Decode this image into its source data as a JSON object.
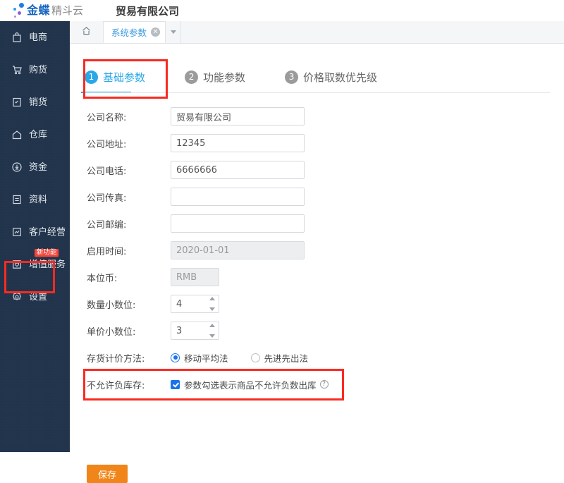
{
  "header": {
    "logo_main": "金蝶",
    "logo_sub": "精斗云",
    "company": "贸易有限公司"
  },
  "tabstrip": {
    "home_icon": "home-icon",
    "doc_tab_label": "系统参数",
    "close_glyph": "✕",
    "caret_icon": "chevron-down-icon"
  },
  "sidebar": {
    "items": [
      {
        "label": "电商",
        "icon": "bag-icon"
      },
      {
        "label": "购货",
        "icon": "cart-icon"
      },
      {
        "label": "销货",
        "icon": "invoice-icon"
      },
      {
        "label": "仓库",
        "icon": "warehouse-icon"
      },
      {
        "label": "资金",
        "icon": "coin-icon"
      },
      {
        "label": "资料",
        "icon": "document-icon"
      },
      {
        "label": "客户经营",
        "icon": "chart-icon"
      },
      {
        "label": "增值服务",
        "icon": "heart-box-icon",
        "badge": "新功能"
      },
      {
        "label": "设置",
        "icon": "gear-icon"
      }
    ]
  },
  "tabs": [
    {
      "num": "1",
      "label": "基础参数",
      "active": true
    },
    {
      "num": "2",
      "label": "功能参数",
      "active": false
    },
    {
      "num": "3",
      "label": "价格取数优先级",
      "active": false
    }
  ],
  "form": {
    "company_name": {
      "label": "公司名称:",
      "value": "贸易有限公司"
    },
    "company_address": {
      "label": "公司地址:",
      "value": "12345"
    },
    "company_phone": {
      "label": "公司电话:",
      "value": "6666666"
    },
    "company_fax": {
      "label": "公司传真:",
      "value": ""
    },
    "company_zip": {
      "label": "公司邮编:",
      "value": ""
    },
    "start_date": {
      "label": "启用时间:",
      "value": "2020-01-01"
    },
    "currency": {
      "label": "本位币:",
      "value": "RMB"
    },
    "qty_decimals": {
      "label": "数量小数位:",
      "value": "4"
    },
    "price_decimals": {
      "label": "单价小数位:",
      "value": "3"
    },
    "valuation": {
      "label": "存货计价方法:",
      "options": [
        {
          "label": "移动平均法",
          "checked": true
        },
        {
          "label": "先进先出法",
          "checked": false
        }
      ]
    },
    "no_negative_stock": {
      "label": "不允许负库存:",
      "checkbox_label": "参数勾选表示商品不允许负数出库",
      "checked": true,
      "help_glyph": "?"
    },
    "save_label": "保存"
  },
  "colors": {
    "sidebar_bg": "#22344b",
    "accent_blue": "#2ba7e8",
    "tab_link_blue": "#3d9ae0",
    "save_orange": "#f08519",
    "highlight_red": "#fa2a21",
    "badge_red": "#f0453a",
    "control_blue": "#1a73e8"
  }
}
